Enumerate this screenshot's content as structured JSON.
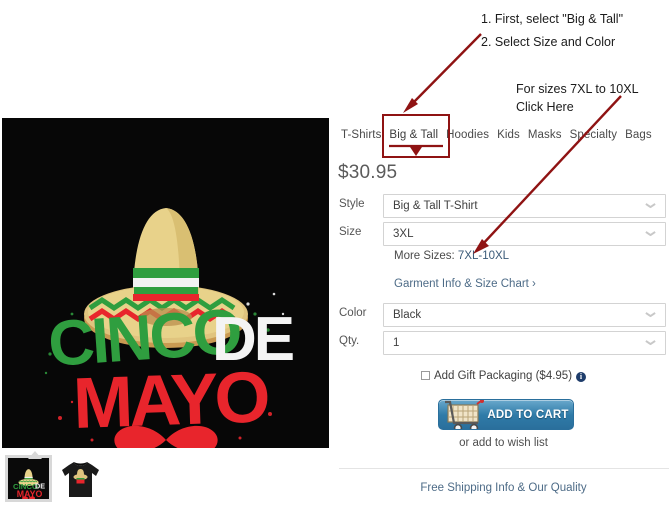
{
  "product": {
    "price": "$30.95",
    "design_title": "CINCO DE MAYO",
    "design_words": {
      "line1a": "CINCO",
      "line1b": "DE",
      "line2": "MAYO"
    },
    "main_image_alt": "cinco-de-mayo-sombrero-design",
    "thumbnails": [
      {
        "name": "design-thumbnail",
        "alt": "cinco-de-mayo-design",
        "selected": true
      },
      {
        "name": "shirt-thumbnail",
        "alt": "black-t-shirt-front",
        "selected": false
      }
    ]
  },
  "tabs": [
    {
      "label": "T-Shirts",
      "active": false
    },
    {
      "label": "Big & Tall",
      "active": true
    },
    {
      "label": "Hoodies",
      "active": false
    },
    {
      "label": "Kids",
      "active": false
    },
    {
      "label": "Masks",
      "active": false
    },
    {
      "label": "Specialty",
      "active": false
    },
    {
      "label": "Bags",
      "active": false
    }
  ],
  "form": {
    "style": {
      "label": "Style",
      "value": "Big & Tall T-Shirt"
    },
    "size": {
      "label": "Size",
      "value": "3XL"
    },
    "color": {
      "label": "Color",
      "value": "Black"
    },
    "qty": {
      "label": "Qty.",
      "value": "1"
    },
    "more_sizes_prefix": "More Sizes: ",
    "more_sizes_link": "7XL-10XL",
    "size_chart_link": "Garment Info & Size Chart ›",
    "gift_packaging_label": "Add Gift Packaging ($4.95)",
    "add_to_cart_label": "ADD TO CART",
    "wish_list_text": "or add to wish list",
    "footer_link": "Free Shipping Info & Our Quality"
  },
  "annotations": {
    "step1": "1. First, select \"Big & Tall\"",
    "step2": "2. Select Size and Color",
    "note_line1": "For sizes 7XL to 10XL",
    "note_line2": "Click Here",
    "highlight_color": "#8f1313",
    "arrow_color": "#8f1313"
  },
  "colors": {
    "accent_blue": "#2f7ba8",
    "link_blue": "#4d6b87",
    "annotation_red": "#8f1313",
    "design_green": "#2f9e3f",
    "design_red": "#e8252c",
    "design_cream": "#e8d28a"
  }
}
